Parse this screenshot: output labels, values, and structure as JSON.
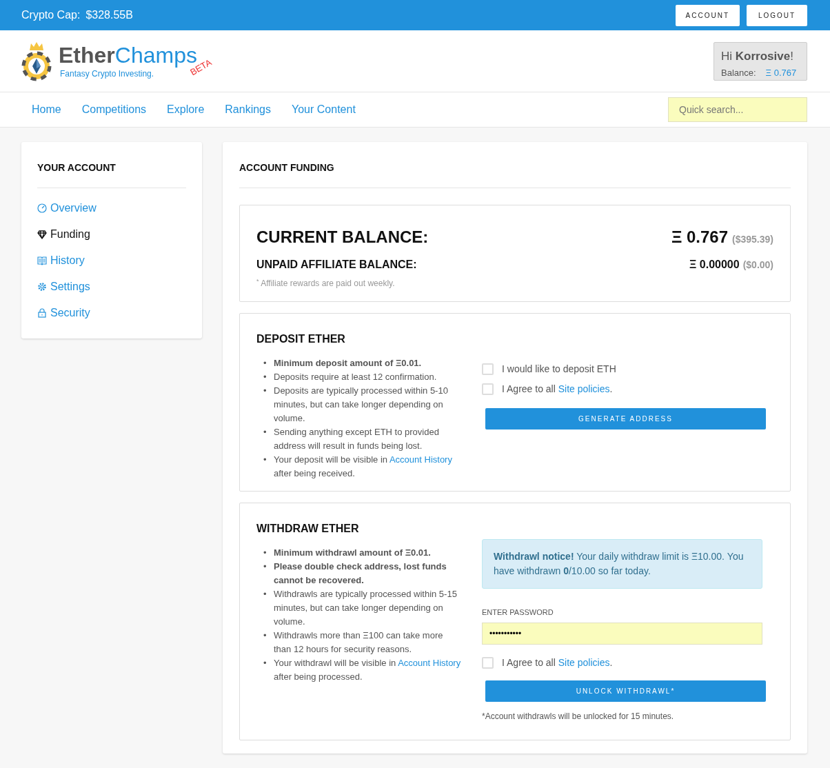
{
  "topbar": {
    "crypto_cap_label": "Crypto Cap:",
    "crypto_cap_value": "$328.55B",
    "buttons": [
      "ACCOUNT",
      "LOGOUT"
    ]
  },
  "brand": {
    "name_dark": "Ether",
    "name_light": "Champs",
    "badge": "BETA",
    "tagline": "Fantasy Crypto Investing."
  },
  "user_box": {
    "greeting": "Hi **Korrosive**!",
    "balance_label": "Balance:",
    "balance_value": "Ξ 0.767"
  },
  "nav": {
    "items": [
      "Home",
      "Competitions",
      "Explore",
      "Rankings",
      "Your Content"
    ],
    "search": {
      "placeholder": "Quick search..."
    }
  },
  "sidebar": {
    "title": "YOUR ACCOUNT",
    "items": [
      {
        "label": "Overview",
        "selected": false
      },
      {
        "label": "Funding",
        "selected": true
      },
      {
        "label": "History",
        "selected": false
      },
      {
        "label": "Settings",
        "selected": false
      },
      {
        "label": "Security",
        "selected": false
      }
    ]
  },
  "main": {
    "title": "ACCOUNT FUNDING",
    "balances": {
      "current_label": "CURRENT BALANCE:",
      "current_value": "Ξ 0.767",
      "current_usd": "($395.39)",
      "affiliate_label": "UNPAID AFFILIATE BALANCE:",
      "affiliate_value": "Ξ 0.00000",
      "affiliate_usd": "($0.00)",
      "note": "$^{*}$ Affiliate rewards are paid out weekly."
    },
    "deposit": {
      "title": "DEPOSIT ETHER",
      "bullet_marker": "•",
      "bullets": [
        {
          "kind": "bold",
          "text": "Minimum deposit amount of Ξ0.01."
        },
        {
          "kind": "plain",
          "text": "Deposits require at least 12 confirmation."
        },
        {
          "kind": "plain",
          "text": "Deposits are typically processed within 5-10 minutes, but can take longer depending on volume."
        },
        {
          "kind": "plain",
          "text": "Sending anything except ETH to provided address will result in funds being lost."
        },
        {
          "kind": "link",
          "text": "Your deposit will be visible in ",
          "link": "Account History",
          "after": " after being received."
        }
      ],
      "checks": [
        {
          "label": "I would like to deposit ETH",
          "checked": false
        },
        {
          "label": "I Agree to all ",
          "link": "Site policies",
          "after": ".",
          "checked": false
        }
      ],
      "button": "GENERATE ADDRESS"
    },
    "withdraw": {
      "title": "WITHDRAW ETHER",
      "bullet_marker": "•",
      "bullets": [
        {
          "kind": "bold",
          "text": "Minimum withdrawl amount of Ξ0.01."
        },
        {
          "kind": "bold",
          "text": "Please double check address, lost funds cannot be recovered."
        },
        {
          "kind": "plain",
          "text": "Withdrawls are typically processed within 5-15 minutes, but can take longer depending on volume."
        },
        {
          "kind": "plain",
          "text": "Withdrawls more than Ξ100 can take more than 12 hours for security reasons."
        },
        {
          "kind": "link",
          "text": "Your withdrawl will be visible in ",
          "link": "Account History",
          "after": " after being processed."
        }
      ],
      "notice": "**Withdrawl notice!** Your daily withdraw limit is Ξ10.00. You have withdrawn **0**/10.00 so far today.",
      "password": {
        "label": "ENTER PASSWORD",
        "value": "•••••••••••"
      },
      "checks": [
        {
          "label": "I Agree to all ",
          "link": "Site policies",
          "after": ".",
          "checked": false
        }
      ],
      "button": "UNLOCK WITHDRAWL*",
      "footnote": "*Account withdrawls will be unlocked for 15 minutes."
    }
  }
}
